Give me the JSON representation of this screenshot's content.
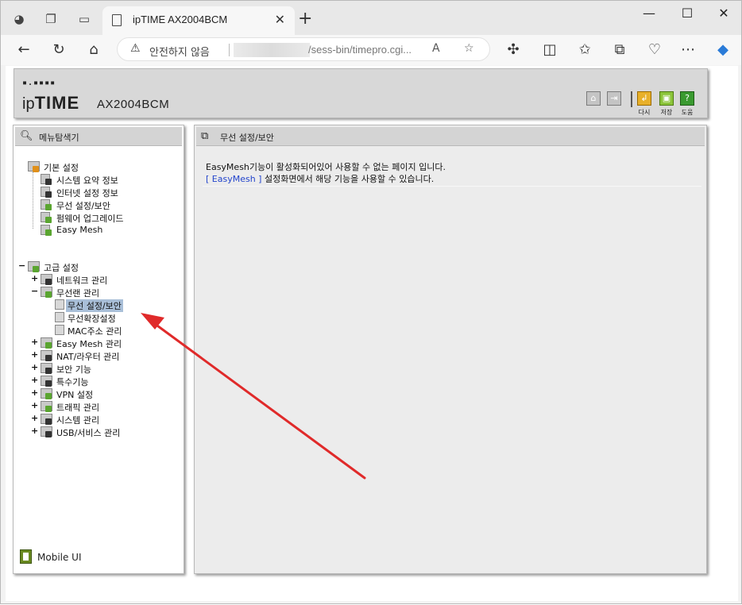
{
  "browser": {
    "tab_title": "ipTIME AX2004BCM",
    "tab_close": "✕",
    "new_tab": "+",
    "window_controls": {
      "minimize": "—",
      "maximize": "☐",
      "close": "✕"
    },
    "security_text": "안전하지 않음",
    "url_visible": "/sess-bin/timepro.cgi...",
    "icons": [
      "workspaces-icon",
      "tab-actions-icon",
      "back-icon",
      "refresh-icon",
      "home-icon",
      "read-aloud-icon",
      "favorite-icon",
      "extensions-icon",
      "split-screen-icon",
      "favorites-icon",
      "collections-icon",
      "browser-essentials-icon",
      "more-icon",
      "copilot-icon"
    ]
  },
  "header": {
    "logo_dots": "▪.▪▪▪▪",
    "logo_ip": "ip",
    "logo_time": "TIME",
    "model": "AX2004BCM",
    "buttons": [
      {
        "name": "home",
        "label": ""
      },
      {
        "name": "logout",
        "label": ""
      },
      {
        "name": "restart",
        "label": "다시"
      },
      {
        "name": "save",
        "label": "저장"
      },
      {
        "name": "help",
        "label": "도움"
      }
    ]
  },
  "left_panel": {
    "title": "메뉴탐색기",
    "basic": {
      "label": "기본 설정",
      "items": [
        "시스템 요약 정보",
        "인터넷 설정 정보",
        "무선 설정/보안",
        "펌웨어 업그레이드",
        "Easy Mesh"
      ]
    },
    "advanced": {
      "label": "고급 설정",
      "toggle": "−",
      "items": [
        {
          "label": "네트워크 관리",
          "toggle": "+"
        },
        {
          "label": "무선랜 관리",
          "toggle": "−",
          "children": [
            "무선 설정/보안",
            "무선확장설정",
            "MAC주소 관리"
          ]
        },
        {
          "label": "Easy Mesh 관리",
          "toggle": "+"
        },
        {
          "label": "NAT/라우터 관리",
          "toggle": "+"
        },
        {
          "label": "보안 기능",
          "toggle": "+"
        },
        {
          "label": "특수기능",
          "toggle": "+"
        },
        {
          "label": "VPN 설정",
          "toggle": "+"
        },
        {
          "label": "트래픽 관리",
          "toggle": "+"
        },
        {
          "label": "시스템 관리",
          "toggle": "+"
        },
        {
          "label": "USB/서비스 관리",
          "toggle": "+"
        }
      ]
    },
    "selected": "무선 설정/보안",
    "mobile": "Mobile UI"
  },
  "right_panel": {
    "title": "무선 설정/보안",
    "message_line1": "EasyMesh기능이 활성화되어있어 사용할 수 없는 페이지 입니다.",
    "message_link": "[ EasyMesh ]",
    "message_line2": " 설정화면에서 해당 기능을 사용할 수 있습니다."
  },
  "colors": {
    "annotation_arrow": "#e02a2a",
    "selected_bg": "#a9bfd8",
    "link": "#2244cc"
  }
}
